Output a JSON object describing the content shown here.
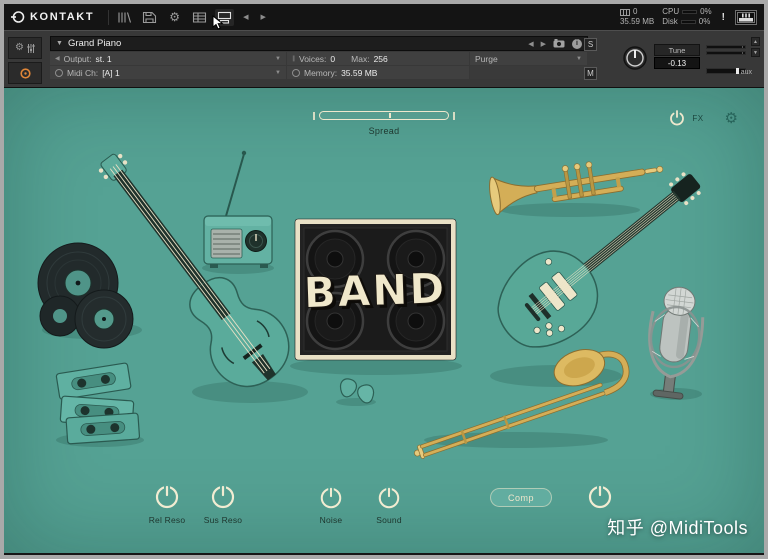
{
  "colors": {
    "teal_bg": "#55a294",
    "cream_accent": "#f2ecd2",
    "brass": "#d4ae57",
    "panel_dark": "#141414",
    "badge_orange": "#e08638"
  },
  "titlebar": {
    "logo": "KONTAKT",
    "voices_count": "0",
    "memory": "35.59 MB",
    "cpu_label": "CPU",
    "cpu_value": "0%",
    "disk_label": "Disk",
    "disk_value": "0%",
    "warning": "!"
  },
  "header": {
    "instrument_name": "Grand Piano",
    "output_label": "Output:",
    "output_value": "st. 1",
    "midi_label": "Midi Ch:",
    "midi_value": "[A] 1",
    "voices_label": "Voices:",
    "voices_value": "0",
    "max_label": "Max:",
    "max_value": "256",
    "memory_label": "Memory:",
    "memory_value": "35.59 MB",
    "purge_label": "Purge",
    "solo_label": "S",
    "mute_label": "M",
    "tune_label": "Tune",
    "tune_value": "-0.13",
    "aux_label": "aux"
  },
  "main": {
    "spread_label": "Spread",
    "fx_label": "FX",
    "band_text": "BAND",
    "controls": [
      {
        "label": "Rel Reso"
      },
      {
        "label": "Sus Reso"
      },
      {
        "label": "Noise"
      },
      {
        "label": "Sound"
      }
    ],
    "comp_label": "Comp"
  },
  "watermark": "知乎 @MidiTools"
}
